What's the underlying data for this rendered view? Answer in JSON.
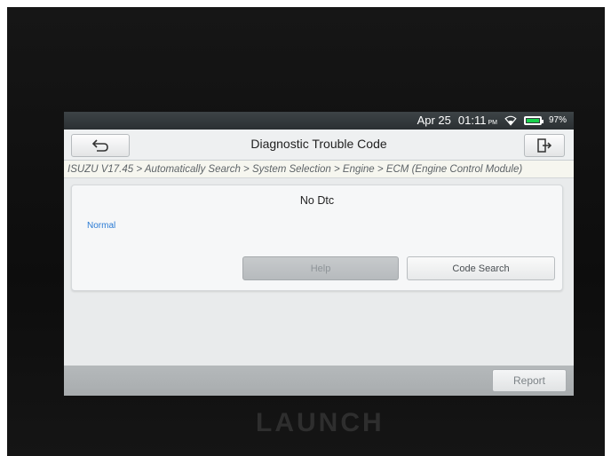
{
  "status": {
    "date": "Apr 25",
    "time": "01:11",
    "ampm": "PM",
    "battery": "97%",
    "battery_level": 0.97,
    "wifi_icon": "wifi-icon",
    "battery_color": "#1ad14d"
  },
  "header": {
    "title": "Diagnostic Trouble Code",
    "back_icon": "back-arrow-icon",
    "exit_icon": "exit-icon"
  },
  "breadcrumb": "ISUZU V17.45 > Automatically Search > System Selection > Engine > ECM (Engine Control Module)",
  "panel": {
    "message": "No Dtc",
    "status": "Normal",
    "help_label": "Help",
    "code_search_label": "Code Search"
  },
  "footer": {
    "report_label": "Report"
  },
  "device": {
    "brand": "LAUNCH"
  },
  "colors": {
    "status_link": "#2b7bd4",
    "screen_bg": "#e9ebec"
  }
}
